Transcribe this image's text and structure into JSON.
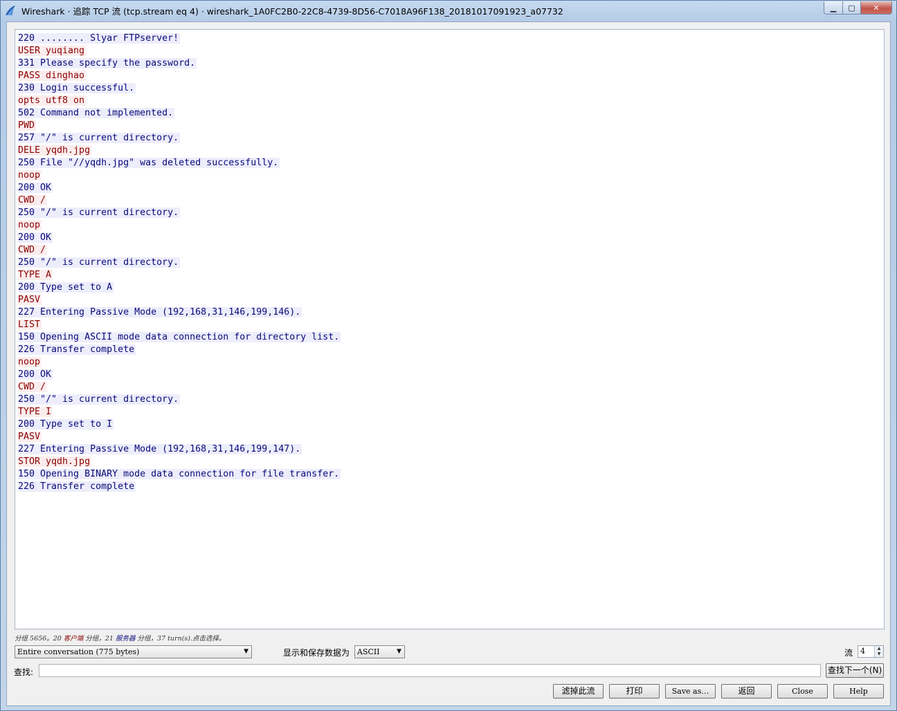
{
  "window": {
    "title": "Wireshark · 追踪 TCP 流 (tcp.stream eq 4) · wireshark_1A0FC2B0-22C8-4739-8D56-C7018A96F138_20181017091923_a07732",
    "minimize_label": "▁",
    "maximize_label": "▢",
    "close_label": "✕"
  },
  "colors": {
    "client_text": "#8b0000",
    "client_bg": "#fbeded",
    "server_text": "#0a0a7a",
    "server_bg": "#ededfb"
  },
  "stream_lines": [
    {
      "side": "server",
      "text": "220 ........ Slyar FTPserver!"
    },
    {
      "side": "client",
      "text": "USER yuqiang"
    },
    {
      "side": "server",
      "text": "331 Please specify the password."
    },
    {
      "side": "client",
      "text": "PASS dinghao"
    },
    {
      "side": "server",
      "text": "230 Login successful."
    },
    {
      "side": "client",
      "text": "opts utf8 on"
    },
    {
      "side": "server",
      "text": "502 Command not implemented."
    },
    {
      "side": "client",
      "text": "PWD"
    },
    {
      "side": "server",
      "text": "257 \"/\" is current directory."
    },
    {
      "side": "client",
      "text": "DELE yqdh.jpg"
    },
    {
      "side": "server",
      "text": "250 File \"//yqdh.jpg\" was deleted successfully."
    },
    {
      "side": "client",
      "text": "noop"
    },
    {
      "side": "server",
      "text": "200 OK"
    },
    {
      "side": "client",
      "text": "CWD /"
    },
    {
      "side": "server",
      "text": "250 \"/\" is current directory."
    },
    {
      "side": "client",
      "text": "noop"
    },
    {
      "side": "server",
      "text": "200 OK"
    },
    {
      "side": "client",
      "text": "CWD /"
    },
    {
      "side": "server",
      "text": "250 \"/\" is current directory."
    },
    {
      "side": "client",
      "text": "TYPE A"
    },
    {
      "side": "server",
      "text": "200 Type set to A"
    },
    {
      "side": "client",
      "text": "PASV"
    },
    {
      "side": "server",
      "text": "227 Entering Passive Mode (192,168,31,146,199,146)."
    },
    {
      "side": "client",
      "text": "LIST"
    },
    {
      "side": "server",
      "text": "150 Opening ASCII mode data connection for directory list."
    },
    {
      "side": "server",
      "text": "226 Transfer complete"
    },
    {
      "side": "client",
      "text": "noop"
    },
    {
      "side": "server",
      "text": "200 OK"
    },
    {
      "side": "client",
      "text": "CWD /"
    },
    {
      "side": "server",
      "text": "250 \"/\" is current directory."
    },
    {
      "side": "client",
      "text": "TYPE I"
    },
    {
      "side": "server",
      "text": "200 Type set to I"
    },
    {
      "side": "client",
      "text": "PASV"
    },
    {
      "side": "server",
      "text": "227 Entering Passive Mode (192,168,31,146,199,147)."
    },
    {
      "side": "client",
      "text": "STOR yqdh.jpg"
    },
    {
      "side": "server",
      "text": "150 Opening BINARY mode data connection for file transfer."
    },
    {
      "side": "server",
      "text": "226 Transfer complete"
    }
  ],
  "stats": {
    "prefix": "分组 5656。20 ",
    "client_word": "客户端",
    "middle": " 分组，21 ",
    "server_word": "服务器",
    "suffix": " 分组，37 turn(s).点击选择。"
  },
  "controls": {
    "conversation_select": "Entire conversation (775 bytes)",
    "show_as_label": "显示和保存数据为",
    "encoding_select": "ASCII",
    "stream_label": "流",
    "stream_value": "4",
    "find_label": "查找:",
    "find_value": "",
    "find_next_button": "查找下一个(N)"
  },
  "buttons": {
    "filter_out": "滤掉此流",
    "print": "打印",
    "save_as": "Save as…",
    "back": "返回",
    "close": "Close",
    "help": "Help"
  }
}
